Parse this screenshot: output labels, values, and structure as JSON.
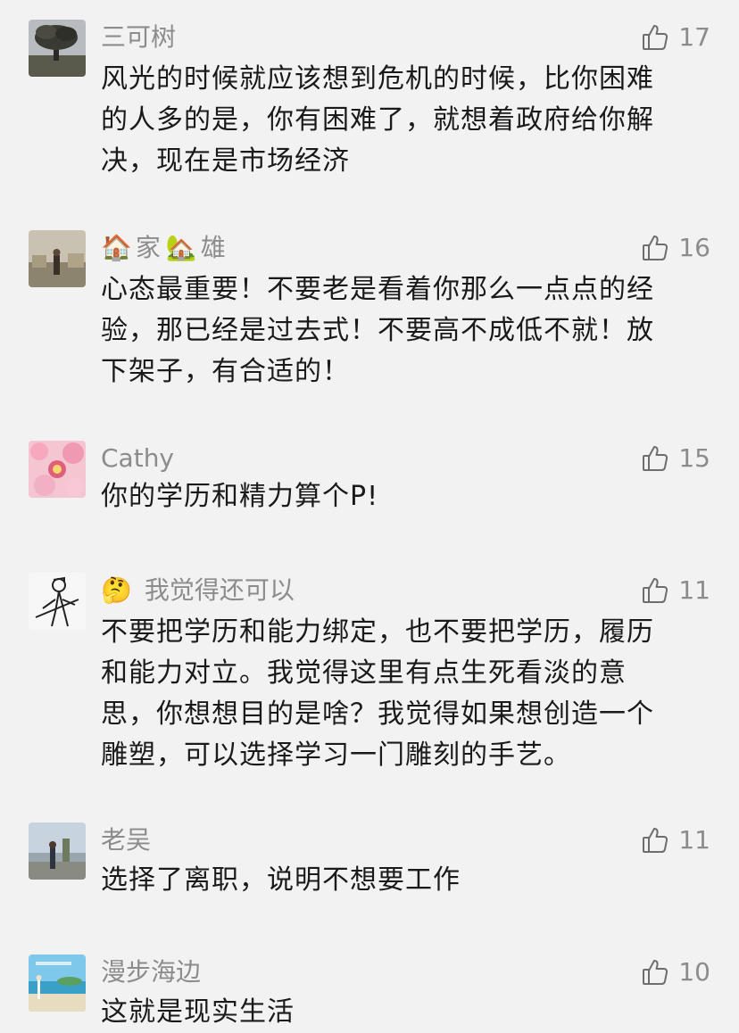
{
  "comments": [
    {
      "nickname": "三可树",
      "likes": "17",
      "lines": [
        "风光的时候就应该想到危机的时候，比你困难",
        "的人多的是，你有困难了，就想着政府给你解",
        "决，现在是市场经济"
      ]
    },
    {
      "nickname_emoji_1": "🏠",
      "nickname_part_1": "家",
      "nickname_emoji_2": "🏡",
      "nickname_part_2": "雄",
      "likes": "16",
      "lines": [
        "心态最重要！不要老是看着你那么一点点的经",
        "验，那已经是过去式！不要高不成低不就！放",
        "下架子，有合适的！"
      ]
    },
    {
      "nickname": "Cathy",
      "likes": "15",
      "lines": [
        "你的学历和精力算个P!"
      ]
    },
    {
      "nickname_emoji": "🤔",
      "nickname": "我觉得还可以",
      "likes": "11",
      "lines": [
        "不要把学历和能力绑定，也不要把学历，履历",
        "和能力对立。我觉得这里有点生死看淡的意",
        "思，你想想目的是啥？我觉得如果想创造一个",
        "雕塑，可以选择学习一门雕刻的手艺。"
      ]
    },
    {
      "nickname": "老吴",
      "likes": "11",
      "lines": [
        "选择了离职，说明不想要工作"
      ]
    },
    {
      "nickname": "漫步海边",
      "likes": "10",
      "lines": [
        "这就是现实生活"
      ]
    }
  ],
  "colors": {
    "text": "#1a1a1a",
    "meta": "#8c8c8c",
    "background": "#f2f2f2"
  },
  "icons": {
    "like": "thumbs-up-icon"
  }
}
